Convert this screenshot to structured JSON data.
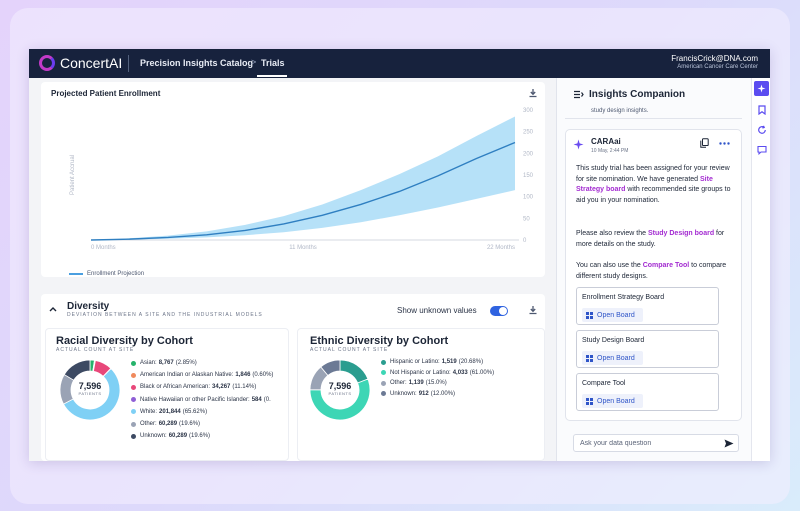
{
  "topbar": {
    "logo_text": "ConcertAI",
    "crumb_catalog": "Precision Insights Catalog",
    "crumb_arrow": ">",
    "crumb_trials": "Trials",
    "user_email": "FrancisCrick@DNA.com",
    "user_org": "American Cancer Care Center"
  },
  "enrollment": {
    "title": "Projected Patient Enrollment",
    "legend": "Enrollment Projection"
  },
  "chart_data": {
    "type": "area",
    "title": "Projected Patient Enrollment",
    "xlabel": "",
    "ylabel": "Patient Accrual",
    "x_ticks": [
      "0 Months",
      "11 Months",
      "22 Months"
    ],
    "y_ticks": [
      "0",
      "50",
      "100",
      "150",
      "200",
      "250",
      "300"
    ],
    "xlim": [
      0,
      22
    ],
    "ylim": [
      0,
      300
    ],
    "series": [
      {
        "name": "Enrollment Projection",
        "x": [
          0,
          2,
          4,
          6,
          8,
          10,
          12,
          14,
          16,
          18,
          20,
          22
        ],
        "values": [
          0,
          2,
          6,
          12,
          22,
          37,
          57,
          82,
          112,
          148,
          188,
          225
        ],
        "lower": [
          0,
          1,
          3,
          6,
          11,
          18,
          28,
          41,
          57,
          75,
          95,
          115
        ],
        "upper": [
          0,
          4,
          10,
          20,
          35,
          55,
          82,
          115,
          152,
          193,
          240,
          285
        ]
      }
    ],
    "colors": {
      "line": "#2f7fc1",
      "band": "#a9dcf7"
    }
  },
  "diversity": {
    "title": "Diversity",
    "subtitle": "DEVIATION BETWEEN A SITE AND THE INDUSTRIAL MODELS",
    "toggle_label": "Show unknown values",
    "toggle_on": true
  },
  "racial": {
    "title": "Racial Diversity by Cohort",
    "subtitle": "ACTUAL COUNT AT SITE",
    "total": "7,596",
    "total_label": "PATIENTS",
    "items": [
      {
        "label": "Asian:",
        "count": "8,767",
        "pct": "(2.85%)",
        "color": "#26b36b",
        "value": 2.85
      },
      {
        "label": "American Indian or Alaskan Native:",
        "count": "1,846",
        "pct": "(0.60%)",
        "color": "#f08a5d",
        "value": 0.6
      },
      {
        "label": "Black or African American:",
        "count": "34,267",
        "pct": "(11.14%)",
        "color": "#e8487a",
        "value": 11.14
      },
      {
        "label": "Native Hawaiian or other Pacific Islander:",
        "count": "584",
        "pct": "(0.",
        "color": "#8f5fd6",
        "value": 0.19
      },
      {
        "label": "White:",
        "count": "201,844",
        "pct": "(65.62%)",
        "color": "#7fd0f5",
        "value": 65.62
      },
      {
        "label": "Other:",
        "count": "60,289",
        "pct": "(19.6%)",
        "color": "#9aa3b5",
        "value": 19.6
      },
      {
        "label": "Unknown:",
        "count": "60,289",
        "pct": "(19.6%)",
        "color": "#3d4a63",
        "value": 19.6
      }
    ]
  },
  "ethnic": {
    "title": "Ethnic Diversity by Cohort",
    "subtitle": "ACTUAL COUNT AT SITE",
    "total": "7,596",
    "total_label": "PATIENTS",
    "items": [
      {
        "label": "Hispanic or Latino:",
        "count": "1,519",
        "pct": "(20.68%)",
        "color": "#2a9d8f",
        "value": 20.68
      },
      {
        "label": "Not Hispanic or Latino:",
        "count": "4,033",
        "pct": "(61.00%)",
        "color": "#3dd6b5",
        "value": 61.0
      },
      {
        "label": "Other:",
        "count": "1,139",
        "pct": "(15.0%)",
        "color": "#9aa3b5",
        "value": 15.0
      },
      {
        "label": "Unknown:",
        "count": "912",
        "pct": "(12.00%)",
        "color": "#6c7a95",
        "value": 12.0
      }
    ]
  },
  "companion": {
    "title": "Insights Companion",
    "prev_text": "study design insights.",
    "sender": "CARAai",
    "time": "10 May, 2:44 PM",
    "p1_a": "This study trial has been assigned for your review for site nomination. We have generated ",
    "p1_link": "Site Strategy board",
    "p1_b": " with recommended site groups to aid you in your nomination.",
    "p2_a": "Please also review the ",
    "p2_link": "Study Design board",
    "p2_b": " for more details on the study.",
    "p3_a": "You can also use the ",
    "p3_link": "Compare Tool",
    "p3_b": " to compare different study designs.",
    "tools": [
      {
        "label": "Enrollment Strategy Board",
        "button": "Open Board"
      },
      {
        "label": "Study Design Board",
        "button": "Open Board"
      },
      {
        "label": "Compare Tool",
        "button": "Open Board"
      }
    ],
    "ask_placeholder": "Ask your data question"
  }
}
